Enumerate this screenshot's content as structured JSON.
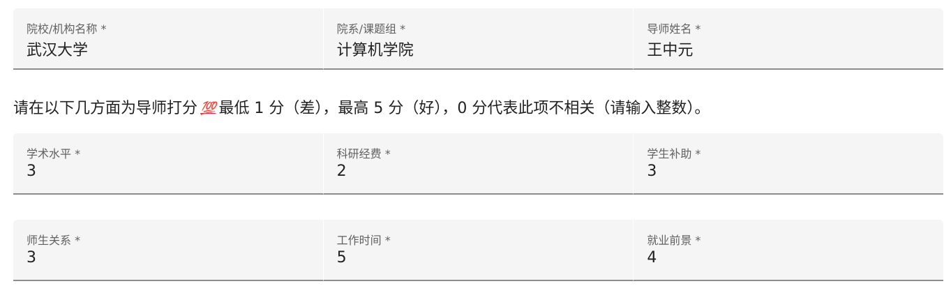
{
  "info_fields": [
    {
      "label": "院校/机构名称 *",
      "value": "武汉大学"
    },
    {
      "label": "院系/课题组 *",
      "value": "计算机学院"
    },
    {
      "label": "导师姓名 *",
      "value": "王中元"
    }
  ],
  "rating_note": {
    "before": "请在以下几方面为导师打分",
    "emoji": "💯",
    "after": "最低 1 分（差），最高 5 分（好），0 分代表此项不相关（请输入整数）。"
  },
  "rating_rows": [
    [
      {
        "label": "学术水平 *",
        "value": "3"
      },
      {
        "label": "科研经费 *",
        "value": "2"
      },
      {
        "label": "学生补助 *",
        "value": "3"
      }
    ],
    [
      {
        "label": "师生关系 *",
        "value": "3"
      },
      {
        "label": "工作时间 *",
        "value": "5"
      },
      {
        "label": "就业前景 *",
        "value": "4"
      }
    ]
  ]
}
